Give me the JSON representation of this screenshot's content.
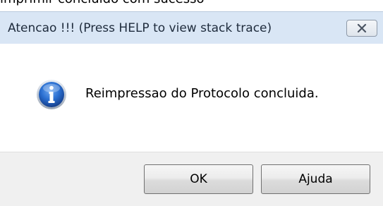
{
  "top_strip": {
    "cut_text": "imprimir concluido com sucesso"
  },
  "dialog": {
    "title": "Atencao !!!  (Press HELP to view stack trace)",
    "message": "Reimpressao do Protocolo concluida.",
    "ok_label": "OK",
    "help_label": "Ajuda"
  },
  "icons": {
    "close": "close-icon",
    "info": "info-icon"
  },
  "colors": {
    "titlebar_bg": "#d9e6f5",
    "footer_bg": "#f0f0f0",
    "info_blue": "#1f5fbf"
  }
}
